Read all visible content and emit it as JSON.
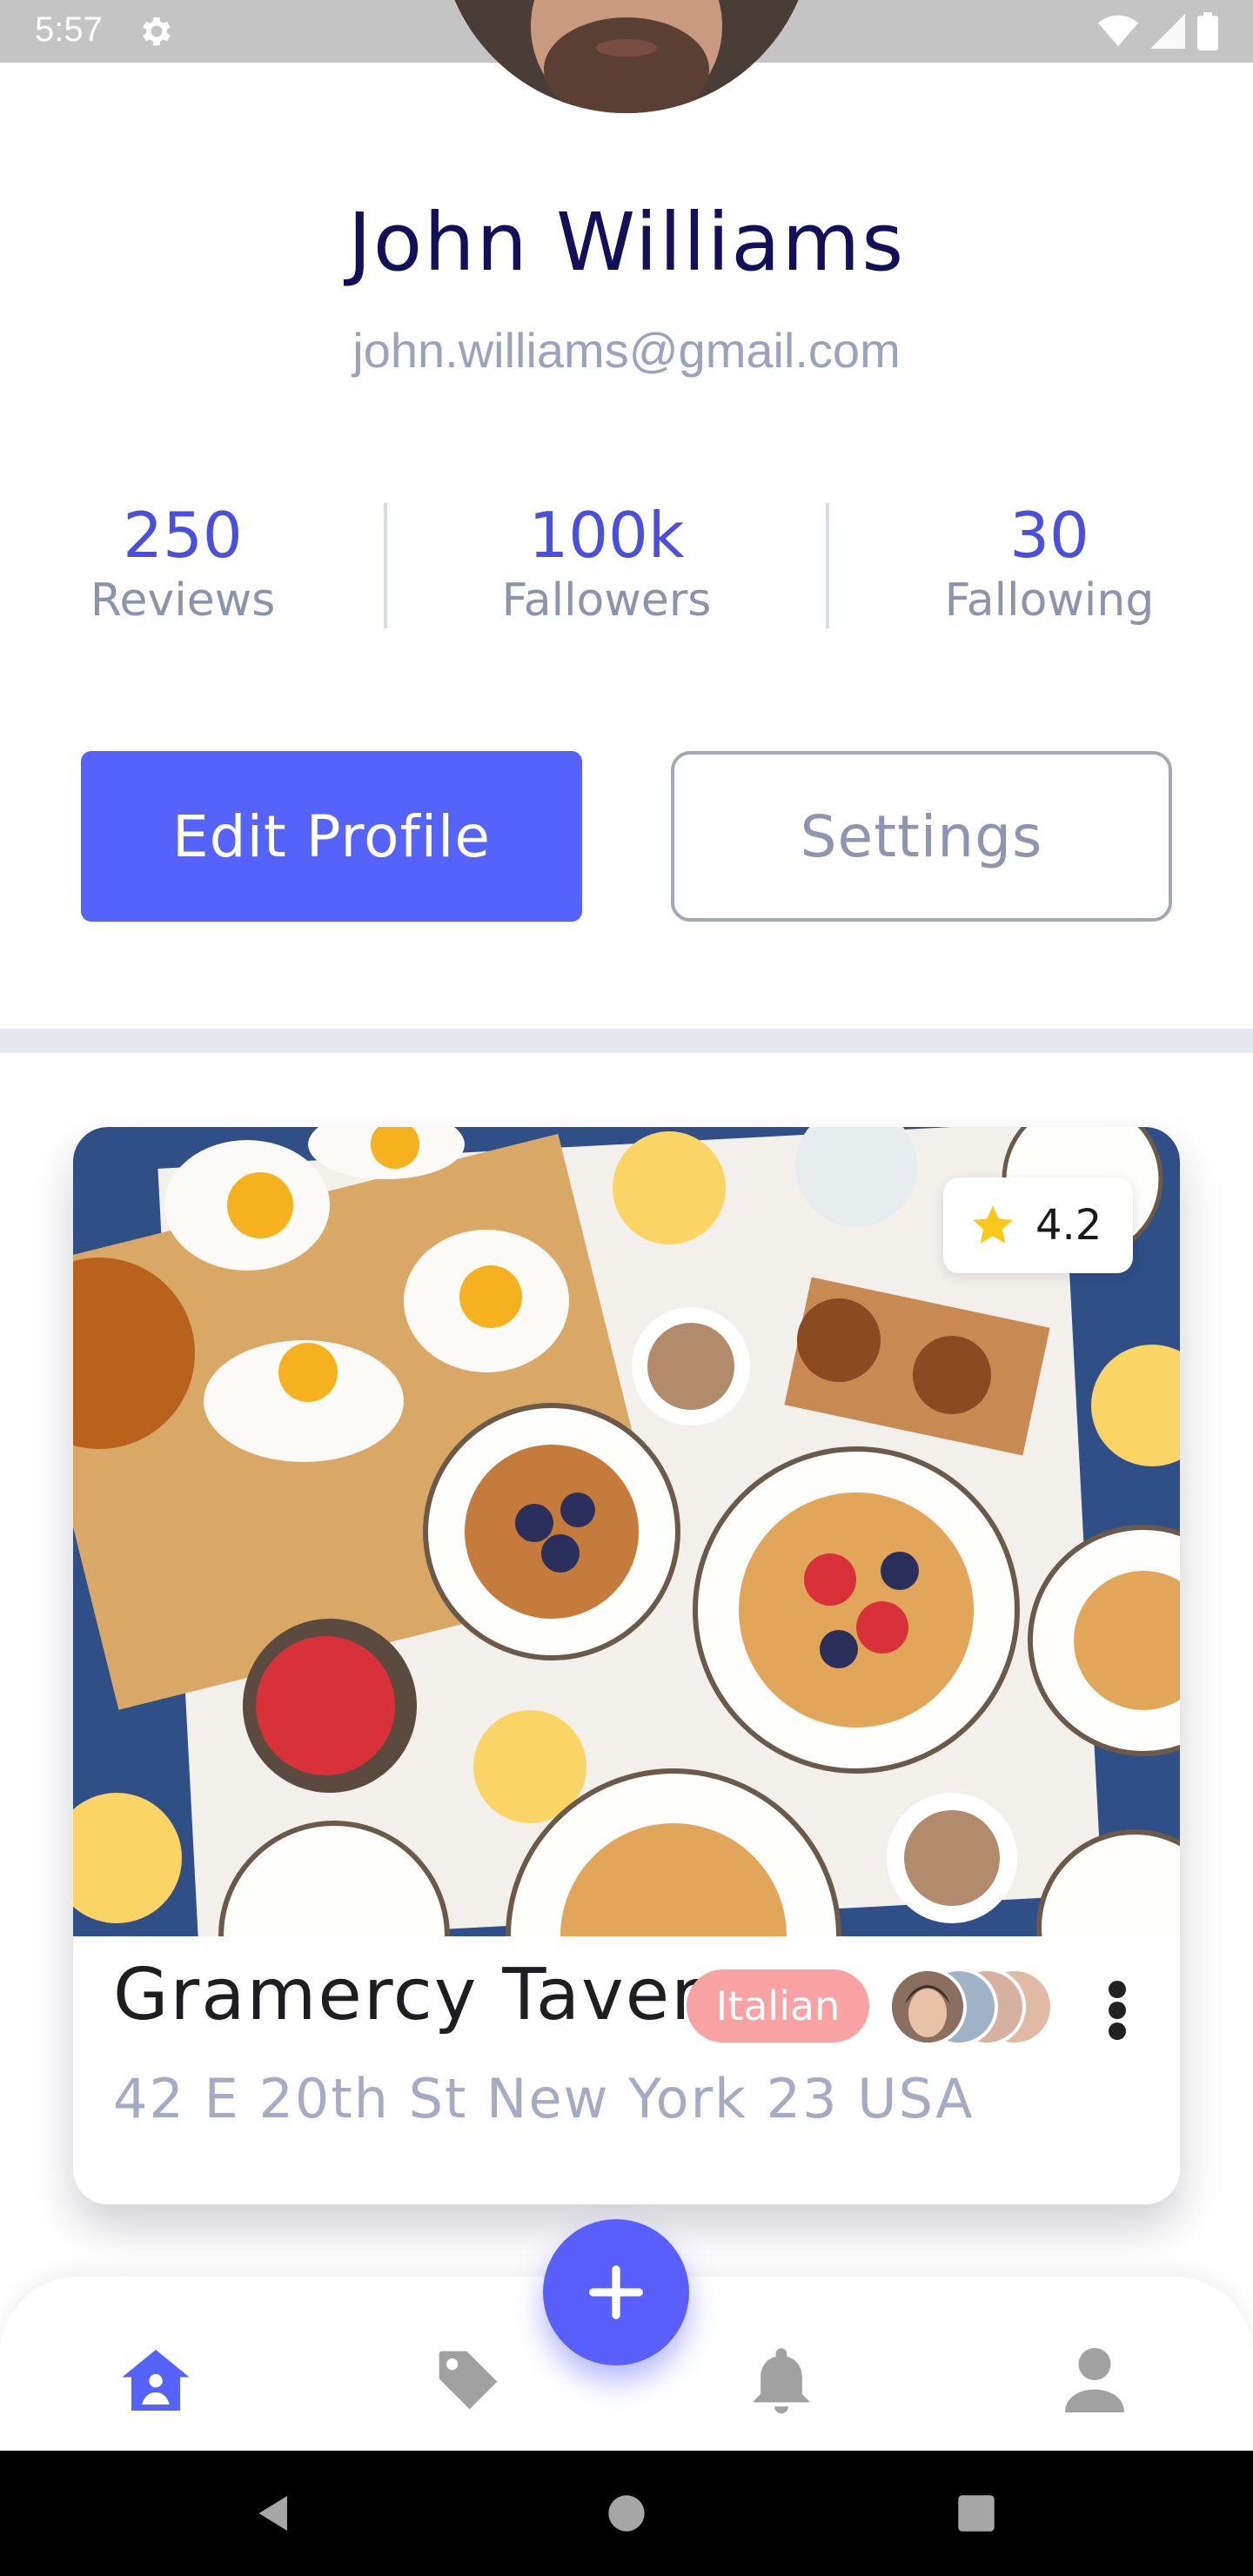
{
  "status_bar": {
    "time": "5:57"
  },
  "profile": {
    "name": "John Williams",
    "email": "john.williams@gmail.com"
  },
  "stats": [
    {
      "value": "250",
      "label": "Reviews"
    },
    {
      "value": "100k",
      "label": "Fallowers"
    },
    {
      "value": "30",
      "label": "Fallowing"
    }
  ],
  "actions": {
    "edit_label": "Edit Profile",
    "settings_label": "Settings"
  },
  "card": {
    "rating": "4.2",
    "title": "Gramercy Tavern",
    "tag": "Italian",
    "address": "42 E 20th St New York 23 USA"
  },
  "bottom_nav": {
    "items": [
      "home-icon",
      "tag-icon",
      "bell-icon",
      "person-icon"
    ],
    "active": "home-icon",
    "fab_icon": "plus-icon"
  },
  "colors": {
    "accent": "#5563fb",
    "name_color": "#13105a",
    "stat_color": "#4a4fe0",
    "tag_color": "#f9a2a4"
  }
}
